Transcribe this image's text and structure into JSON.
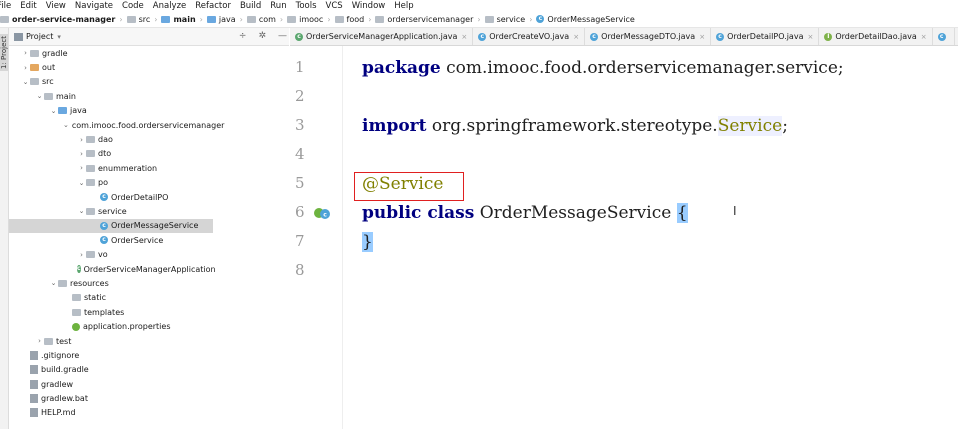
{
  "menu": [
    "File",
    "Edit",
    "View",
    "Navigate",
    "Code",
    "Analyze",
    "Refactor",
    "Build",
    "Run",
    "Tools",
    "VCS",
    "Window",
    "Help"
  ],
  "breadcrumb": {
    "project": "order-service-manager",
    "items": [
      "src",
      "main",
      "java",
      "com",
      "imooc",
      "food",
      "orderservicemanager",
      "service",
      "OrderMessageService"
    ]
  },
  "project_panel": {
    "title": "Project",
    "side_label": "1: Project"
  },
  "tree": [
    {
      "label": "gradle",
      "indent": 1,
      "arrow": ">",
      "icon": "folder"
    },
    {
      "label": "out",
      "indent": 1,
      "arrow": ">",
      "icon": "folder-orange"
    },
    {
      "label": "src",
      "indent": 1,
      "arrow": "v",
      "icon": "folder"
    },
    {
      "label": "main",
      "indent": 2,
      "arrow": "v",
      "icon": "folder"
    },
    {
      "label": "java",
      "indent": 3,
      "arrow": "v",
      "icon": "folder-blue"
    },
    {
      "label": "com.imooc.food.orderservicemanager",
      "indent": 4,
      "arrow": "v",
      "icon": "folder"
    },
    {
      "label": "dao",
      "indent": 5,
      "arrow": ">",
      "icon": "folder"
    },
    {
      "label": "dto",
      "indent": 5,
      "arrow": ">",
      "icon": "folder"
    },
    {
      "label": "enummeration",
      "indent": 5,
      "arrow": ">",
      "icon": "folder"
    },
    {
      "label": "po",
      "indent": 5,
      "arrow": "v",
      "icon": "folder"
    },
    {
      "label": "OrderDetailPO",
      "indent": 6,
      "arrow": "",
      "icon": "class"
    },
    {
      "label": "service",
      "indent": 5,
      "arrow": "v",
      "icon": "folder"
    },
    {
      "label": "OrderMessageService",
      "indent": 6,
      "arrow": "",
      "icon": "class",
      "selected": true
    },
    {
      "label": "OrderService",
      "indent": 6,
      "arrow": "",
      "icon": "class"
    },
    {
      "label": "vo",
      "indent": 5,
      "arrow": ">",
      "icon": "folder"
    },
    {
      "label": "OrderServiceManagerApplication",
      "indent": 5,
      "arrow": "",
      "icon": "spring-class"
    },
    {
      "label": "resources",
      "indent": 3,
      "arrow": "v",
      "icon": "folder"
    },
    {
      "label": "static",
      "indent": 4,
      "arrow": "",
      "icon": "folder"
    },
    {
      "label": "templates",
      "indent": 4,
      "arrow": "",
      "icon": "folder"
    },
    {
      "label": "application.properties",
      "indent": 4,
      "arrow": "",
      "icon": "spring"
    },
    {
      "label": "test",
      "indent": 2,
      "arrow": ">",
      "icon": "folder"
    },
    {
      "label": ".gitignore",
      "indent": 1,
      "arrow": "",
      "icon": "file"
    },
    {
      "label": "build.gradle",
      "indent": 1,
      "arrow": "",
      "icon": "file"
    },
    {
      "label": "gradlew",
      "indent": 1,
      "arrow": "",
      "icon": "file"
    },
    {
      "label": "gradlew.bat",
      "indent": 1,
      "arrow": "",
      "icon": "file"
    },
    {
      "label": "HELP.md",
      "indent": 1,
      "arrow": "",
      "icon": "file"
    }
  ],
  "tabs": [
    {
      "label": "OrderServiceManagerApplication.java",
      "icon": "spring-class"
    },
    {
      "label": "OrderCreateVO.java",
      "icon": "class"
    },
    {
      "label": "OrderMessageDTO.java",
      "icon": "class"
    },
    {
      "label": "OrderDetailPO.java",
      "icon": "class"
    },
    {
      "label": "OrderDetailDao.java",
      "icon": "interface"
    }
  ],
  "line_numbers": [
    "1",
    "2",
    "3",
    "4",
    "5",
    "6",
    "7",
    "8"
  ],
  "code": {
    "l1_kw": "package",
    "l1_rest": " com.imooc.food.orderservicemanager.service;",
    "l3_kw": "import",
    "l3_rest": " org.springframework.stereotype.",
    "l3_svc": "Service",
    "l3_end": ";",
    "l5_ann": "@Service",
    "l6_kw": "public class",
    "l6_name": " OrderMessageService ",
    "l6_brace": "{",
    "l7_brace": "}"
  },
  "colors": {
    "keyword": "#000080",
    "annotation": "#808000",
    "highlight_box": "#e02020"
  }
}
